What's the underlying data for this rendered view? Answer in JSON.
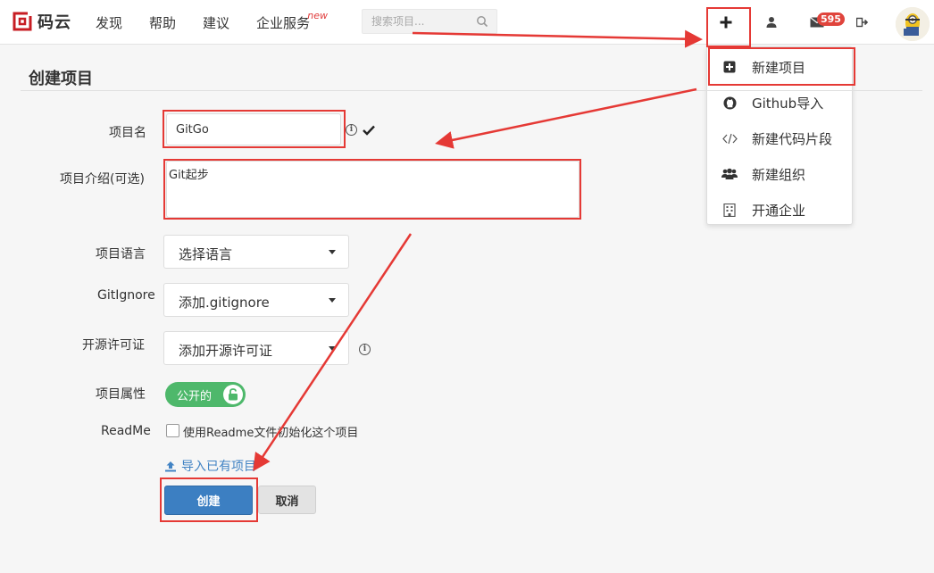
{
  "brand": {
    "name": "码云"
  },
  "nav": {
    "items": [
      "发现",
      "帮助",
      "建议",
      "企业服务"
    ],
    "new_tag": "new"
  },
  "search": {
    "placeholder": "搜索项目..."
  },
  "notifications": {
    "count": "595"
  },
  "dropdown": {
    "items": [
      "新建项目",
      "Github导入",
      "新建代码片段",
      "新建组织",
      "开通企业"
    ]
  },
  "page": {
    "title": "创建项目"
  },
  "form": {
    "name_label": "项目名",
    "name_value": "GitGo",
    "desc_label": "项目介绍(可选)",
    "desc_value": "Git起步",
    "lang_label": "项目语言",
    "lang_value": "选择语言",
    "gitignore_label": "GitIgnore",
    "gitignore_value": "添加.gitignore",
    "license_label": "开源许可证",
    "license_value": "添加开源许可证",
    "visibility_label": "项目属性",
    "visibility_value": "公开的",
    "readme_label": "ReadMe",
    "readme_text": "使用Readme文件初始化这个项目",
    "import_link": "导入已有项目",
    "create_button": "创建",
    "cancel_button": "取消"
  },
  "colors": {
    "highlight": "#e53935",
    "primary": "#3c7fc2",
    "toggle_green": "#4eb86b",
    "badge": "#e0443c"
  }
}
